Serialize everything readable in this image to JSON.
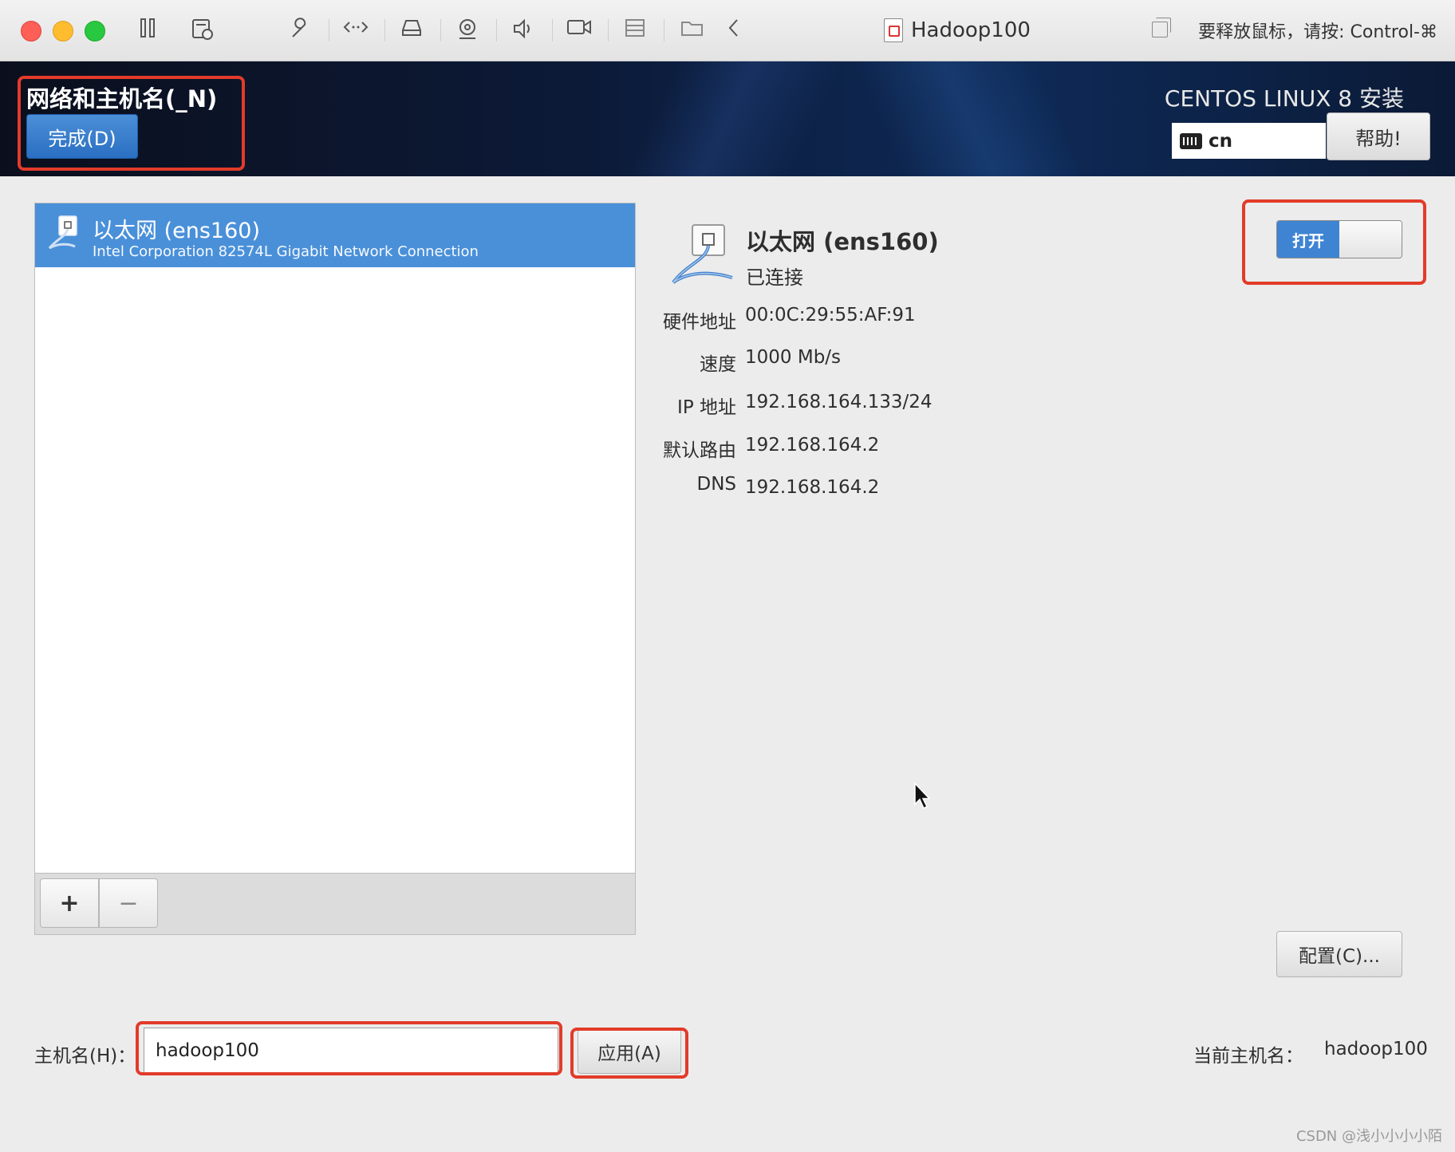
{
  "window": {
    "title": "Hadoop100",
    "release_hint": "要释放鼠标，请按: Control-⌘",
    "toolbar_icons": [
      "pause-icon",
      "snapshot-icon",
      "wrench-icon",
      "code-arrows-icon",
      "disk-icon",
      "camera-icon",
      "speaker-icon",
      "video-icon",
      "list-icon",
      "folder-icon",
      "chevron-left-icon",
      "copy-icon"
    ]
  },
  "header": {
    "spoke_title": "网络和主机名(_N)",
    "done_label": "完成(D)",
    "product_title": "CENTOS LINUX 8 安装",
    "keyboard_layout": "cn",
    "help_label": "帮助!"
  },
  "device_list": {
    "items": [
      {
        "name": "以太网 (ens160)",
        "description": "Intel Corporation 82574L Gigabit Network Connection",
        "selected": true
      }
    ],
    "add_label": "+",
    "remove_label": "−"
  },
  "detail": {
    "name": "以太网 (ens160)",
    "status": "已连接",
    "toggle_label": "打开",
    "toggle_on": true,
    "fields": [
      {
        "label": "硬件地址",
        "value": "00:0C:29:55:AF:91"
      },
      {
        "label": "速度",
        "value": "1000 Mb/s"
      },
      {
        "label": "IP 地址",
        "value": "192.168.164.133/24"
      },
      {
        "label": "默认路由",
        "value": "192.168.164.2"
      },
      {
        "label": "DNS",
        "value": "192.168.164.2"
      }
    ],
    "config_label": "配置(C)..."
  },
  "hostname": {
    "label": "主机名(H)：",
    "value": "hadoop100",
    "apply_label": "应用(A)",
    "current_label": "当前主机名：",
    "current_value": "hadoop100"
  },
  "colors": {
    "highlight_red": "#e23b2a",
    "accent_blue": "#4a90d9"
  },
  "watermark": "CSDN @浅小小小小陌"
}
